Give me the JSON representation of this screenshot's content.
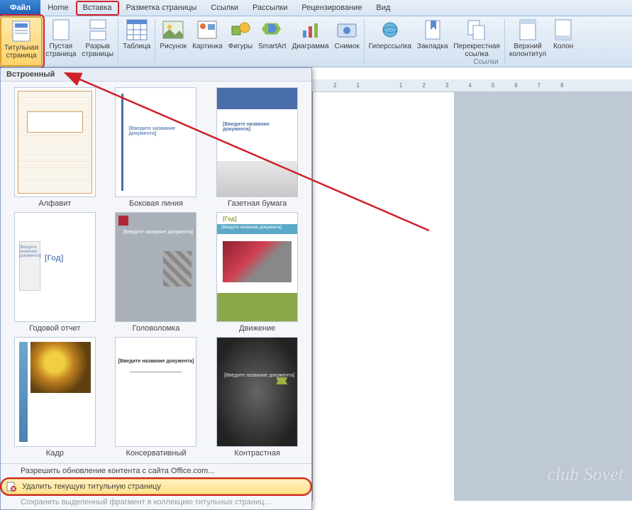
{
  "tabs": {
    "file": "Файл",
    "items": [
      "Home",
      "Вставка",
      "Разметка страницы",
      "Ссылки",
      "Рассылки",
      "Рецензирование",
      "Вид"
    ],
    "highlighted_index": 1
  },
  "ribbon": {
    "buttons": [
      {
        "label": "Титульная\nстраница",
        "hl": true
      },
      {
        "label": "Пустая\nстраница"
      },
      {
        "label": "Разрыв\nстраницы"
      },
      {
        "label": "Таблица"
      },
      {
        "label": "Рисунок"
      },
      {
        "label": "Картинка"
      },
      {
        "label": "Фигуры"
      },
      {
        "label": "SmartArt"
      },
      {
        "label": "Диаграмма"
      },
      {
        "label": "Снимок"
      },
      {
        "label": "Гиперссылка"
      },
      {
        "label": "Закладка"
      },
      {
        "label": "Перекрестная\nссылка"
      },
      {
        "label": "Верхний\nколонтитул"
      },
      {
        "label": "Колон"
      }
    ],
    "group_links": "Ссылки"
  },
  "gallery": {
    "header": "Встроенный",
    "templates": [
      {
        "label": "Алфавит",
        "style": "alphabet"
      },
      {
        "label": "Боковая линия",
        "style": "sideline"
      },
      {
        "label": "Газетная бумага",
        "style": "newspaper"
      },
      {
        "label": "Годовой отчет",
        "style": "annual"
      },
      {
        "label": "Головоломка",
        "style": "puzzle"
      },
      {
        "label": "Движение",
        "style": "motion"
      },
      {
        "label": "Кадр",
        "style": "frame"
      },
      {
        "label": "Консервативный",
        "style": "conservative"
      },
      {
        "label": "Контрастная",
        "style": "contrast"
      }
    ],
    "footer": {
      "item1": "Разрешить обновление контента с сайта Office.com...",
      "item2": "Удалить текущую титульную страницу",
      "item3": "Сохранить выделенный фрагмент в коллекцию титульных страниц..."
    }
  },
  "ruler_marks": [
    "2",
    "1",
    "",
    "1",
    "2",
    "3",
    "4",
    "5",
    "6",
    "7",
    "8"
  ],
  "placeholders": {
    "doc_title": "[Введите название документа]",
    "year": "[Год]"
  },
  "watermark": "club Sovet"
}
